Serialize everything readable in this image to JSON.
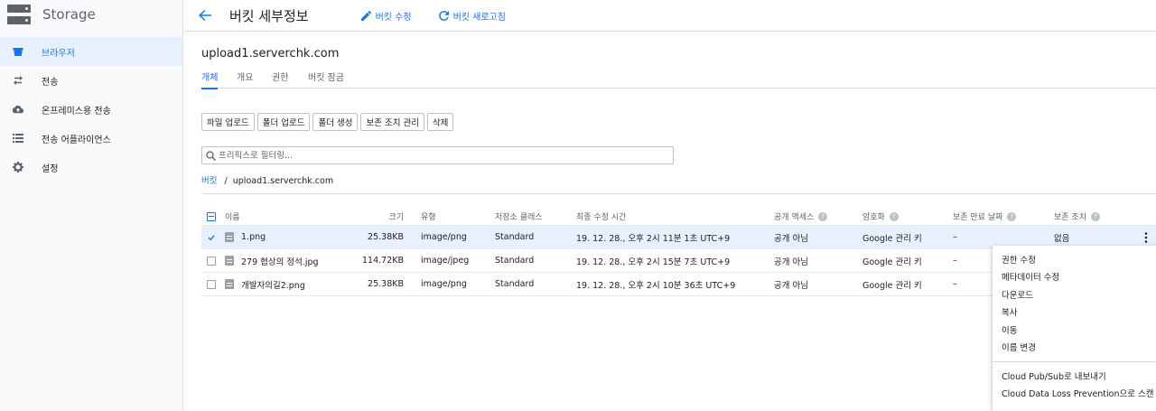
{
  "app": {
    "title": "Storage"
  },
  "sidebar": {
    "items": [
      {
        "label": "브라우저",
        "icon": "bucket-icon",
        "active": true
      },
      {
        "label": "전송",
        "icon": "transfer-icon",
        "active": false
      },
      {
        "label": "온프레미스용 전송",
        "icon": "cloud-upload-icon",
        "active": false
      },
      {
        "label": "전송 어플라이언스",
        "icon": "appliance-list-icon",
        "active": false
      },
      {
        "label": "설정",
        "icon": "gear-icon",
        "active": false
      }
    ]
  },
  "header": {
    "title": "버킷 세부정보",
    "edit_label": "버킷 수정",
    "refresh_label": "버킷 새로고침"
  },
  "bucket": {
    "name": "upload1.serverchk.com"
  },
  "tabs": [
    "개체",
    "개요",
    "권한",
    "버킷 잠금"
  ],
  "toolbar": {
    "upload_file": "파일 업로드",
    "upload_folder": "폴더 업로드",
    "create_folder": "폴더 생성",
    "manage_holds": "보존 조치 관리",
    "delete": "삭제"
  },
  "filter": {
    "placeholder": "프리픽스로 필터링..."
  },
  "breadcrumb": {
    "root": "버킷",
    "separator": "/",
    "current": "upload1.serverchk.com"
  },
  "table": {
    "columns": {
      "name": "이름",
      "size": "크기",
      "type": "유형",
      "storage_class": "저장소 클래스",
      "last_modified": "최종 수정 시간",
      "public_access": "공개 액세스",
      "encryption": "암호화",
      "retention_expiry": "보존 만료 날짜",
      "hold": "보존 조치"
    },
    "rows": [
      {
        "name": "1.png",
        "size": "25.38KB",
        "type": "image/png",
        "storage_class": "Standard",
        "last_modified": "19. 12. 28., 오후 2시 11분 1초 UTC+9",
        "public_access": "공개 아님",
        "encryption": "Google 관리 키",
        "retention_expiry": "–",
        "hold": "없음",
        "checked": true
      },
      {
        "name": "279 협상의 정석.jpg",
        "size": "114.72KB",
        "type": "image/jpeg",
        "storage_class": "Standard",
        "last_modified": "19. 12. 28., 오후 2시 15분 7초 UTC+9",
        "public_access": "공개 아님",
        "encryption": "Google 관리 키",
        "retention_expiry": "–",
        "hold": "",
        "checked": false
      },
      {
        "name": "개발자의길2.png",
        "size": "25.38KB",
        "type": "image/png",
        "storage_class": "Standard",
        "last_modified": "19. 12. 28., 오후 2시 10분 36초 UTC+9",
        "public_access": "공개 아님",
        "encryption": "Google 관리 키",
        "retention_expiry": "–",
        "hold": "",
        "checked": false
      }
    ]
  },
  "context_menu": {
    "items": [
      "권한 수정",
      "메타데이터 수정",
      "다운로드",
      "복사",
      "이동",
      "이름 변경"
    ],
    "integrations": [
      "Cloud Pub/Sub로 내보내기",
      "Cloud Data Loss Prevention으로 스캔"
    ]
  }
}
